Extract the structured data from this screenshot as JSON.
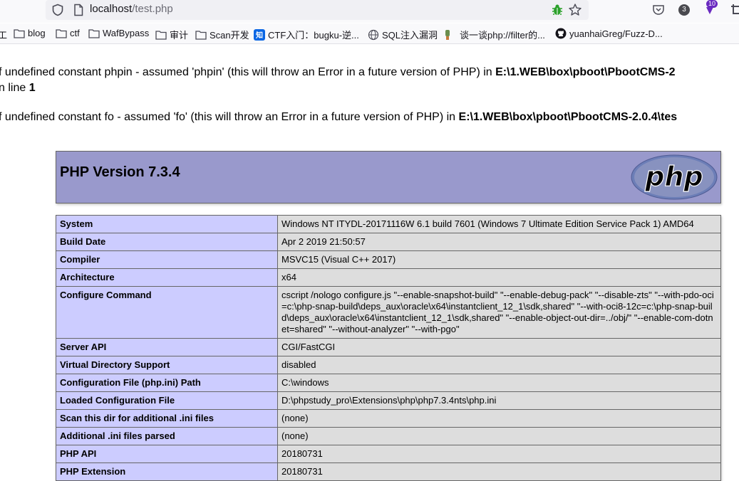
{
  "browser": {
    "url_host": "localhost",
    "url_path": "/test.php",
    "badges": {
      "account_count": "3",
      "extension_count": "10"
    },
    "bookmarks": [
      {
        "icon": "folder-icon",
        "label": "blog"
      },
      {
        "icon": "folder-icon",
        "label": "ctf"
      },
      {
        "icon": "folder-icon",
        "label": "WafBypass"
      },
      {
        "icon": "folder-icon",
        "label": "审计"
      },
      {
        "icon": "folder-icon",
        "label": "Scan开发"
      },
      {
        "icon": "zhihu-icon",
        "label": "CTF入门：bugku-逆..."
      },
      {
        "icon": "globe-icon",
        "label": "SQL注入漏洞"
      },
      {
        "icon": "site-icon",
        "label": "谈一谈php://filter的..."
      },
      {
        "icon": "github-icon",
        "label": "yuanhaiGreg/Fuzz-D..."
      }
    ],
    "bookmark_partial_first": "工"
  },
  "errors": [
    {
      "text": "f undefined constant phpin - assumed 'phpin' (this will throw an Error in a future version of PHP) in ",
      "file": "E:\\1.WEB\\box\\pboot\\PbootCMS-2",
      "line_prefix": "n line ",
      "line_no": "1"
    },
    {
      "text": "f undefined constant fo - assumed 'fo' (this will throw an Error in a future version of PHP) in ",
      "file": "E:\\1.WEB\\box\\pboot\\PbootCMS-2.0.4\\tes"
    }
  ],
  "phpinfo": {
    "version_title": "PHP Version 7.3.4",
    "logo_text": "php",
    "rows": [
      {
        "name": "System",
        "value": "Windows NT ITYDL-20171116W 6.1 build 7601 (Windows 7 Ultimate Edition Service Pack 1) AMD64"
      },
      {
        "name": "Build Date",
        "value": "Apr 2 2019 21:50:57"
      },
      {
        "name": "Compiler",
        "value": "MSVC15 (Visual C++ 2017)"
      },
      {
        "name": "Architecture",
        "value": "x64"
      },
      {
        "name": "Configure Command",
        "value": "cscript /nologo configure.js \"--enable-snapshot-build\" \"--enable-debug-pack\" \"--disable-zts\" \"--with-pdo-oci=c:\\php-snap-build\\deps_aux\\oracle\\x64\\instantclient_12_1\\sdk,shared\" \"--with-oci8-12c=c:\\php-snap-build\\deps_aux\\oracle\\x64\\instantclient_12_1\\sdk,shared\" \"--enable-object-out-dir=../obj/\" \"--enable-com-dotnet=shared\" \"--without-analyzer\" \"--with-pgo\""
      },
      {
        "name": "Server API",
        "value": "CGI/FastCGI"
      },
      {
        "name": "Virtual Directory Support",
        "value": "disabled"
      },
      {
        "name": "Configuration File (php.ini) Path",
        "value": "C:\\windows"
      },
      {
        "name": "Loaded Configuration File",
        "value": "D:\\phpstudy_pro\\Extensions\\php\\php7.3.4nts\\php.ini"
      },
      {
        "name": "Scan this dir for additional .ini files",
        "value": "(none)"
      },
      {
        "name": "Additional .ini files parsed",
        "value": "(none)"
      },
      {
        "name": "PHP API",
        "value": "20180731"
      },
      {
        "name": "PHP Extension",
        "value": "20180731"
      }
    ]
  },
  "colors": {
    "header_bg": "#9999cc",
    "name_cell_bg": "#ccccff",
    "value_cell_bg": "#dddddd",
    "border": "#666666"
  }
}
